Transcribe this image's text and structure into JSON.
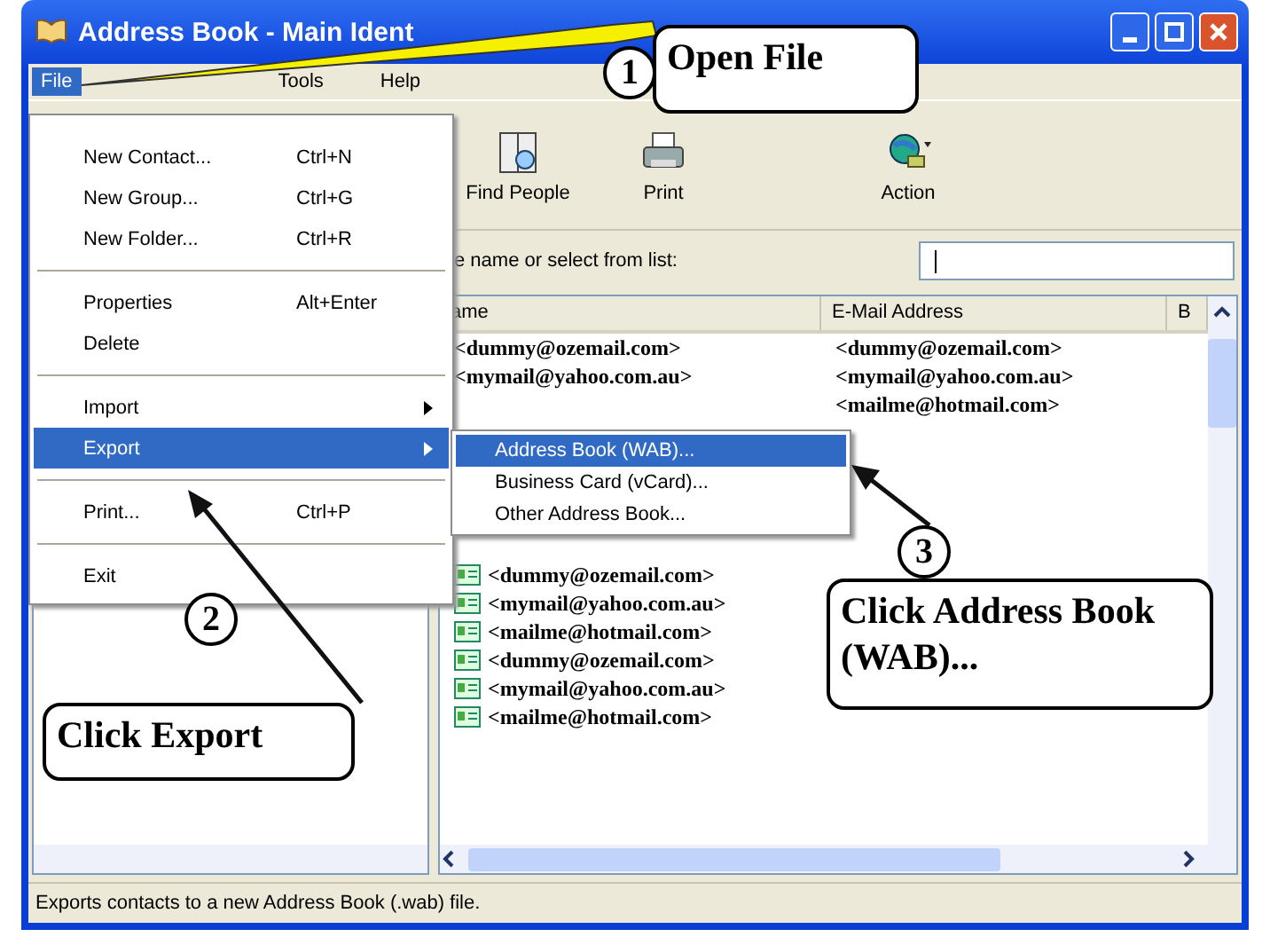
{
  "window": {
    "title": "Address Book - Main Ident"
  },
  "menu_bar": [
    {
      "label": "File",
      "selected": true
    },
    {
      "label": "Tools",
      "selected": false
    },
    {
      "label": "Help",
      "selected": false
    }
  ],
  "toolbar": [
    {
      "kind": "find",
      "label": "Find People"
    },
    {
      "kind": "print",
      "label": "Print"
    },
    {
      "kind": "action",
      "label": "Action"
    }
  ],
  "search": {
    "label": "e name or select from list:"
  },
  "table": {
    "columns": [
      "ame",
      "E-Mail Address",
      "B"
    ],
    "rows_above_menu": [
      {
        "name": "<dummy@ozemail.com>",
        "email": "<dummy@ozemail.com>"
      },
      {
        "name": "<mymail@yahoo.com.au>",
        "email": "<mymail@yahoo.com.au>"
      },
      {
        "email": "<mailme@hotmail.com>"
      }
    ],
    "rows_below_menu": [
      {
        "name": "<dummy@ozemail.com>"
      },
      {
        "name": "<mymail@yahoo.com.au>"
      },
      {
        "name": "<mailme@hotmail.com>"
      },
      {
        "name": "<dummy@ozemail.com>"
      },
      {
        "name": "<mymail@yahoo.com.au>"
      },
      {
        "name": "<mailme@hotmail.com>"
      }
    ]
  },
  "file_menu": [
    {
      "kind": "item",
      "label": "New Contact...",
      "shortcut": "Ctrl+N",
      "selected": false
    },
    {
      "kind": "item",
      "label": "New Group...",
      "shortcut": "Ctrl+G",
      "selected": false
    },
    {
      "kind": "item",
      "label": "New Folder...",
      "shortcut": "Ctrl+R",
      "selected": false
    },
    {
      "kind": "separator"
    },
    {
      "kind": "item",
      "label": "Properties",
      "shortcut": "Alt+Enter",
      "selected": false
    },
    {
      "kind": "item",
      "label": "Delete",
      "selected": false
    },
    {
      "kind": "separator"
    },
    {
      "kind": "submenu",
      "label": "Import",
      "selected": false
    },
    {
      "kind": "submenu",
      "label": "Export",
      "selected": true
    },
    {
      "kind": "separator"
    },
    {
      "kind": "item",
      "label": "Print...",
      "shortcut": "Ctrl+P",
      "selected": false
    },
    {
      "kind": "separator"
    },
    {
      "kind": "item",
      "label": "Exit",
      "selected": false
    }
  ],
  "export_submenu": [
    {
      "label": "Address Book (WAB)...",
      "selected": true
    },
    {
      "label": "Business Card (vCard)...",
      "selected": false
    },
    {
      "label": "Other Address Book...",
      "selected": false
    }
  ],
  "callouts": [
    {
      "number": "1",
      "text": "Open File"
    },
    {
      "number": "2",
      "text": "Click Export"
    },
    {
      "number": "3",
      "text": "Click Address Book (WAB)..."
    }
  ],
  "status_bar": "Exports contacts to a new Address Book (.wab) file."
}
